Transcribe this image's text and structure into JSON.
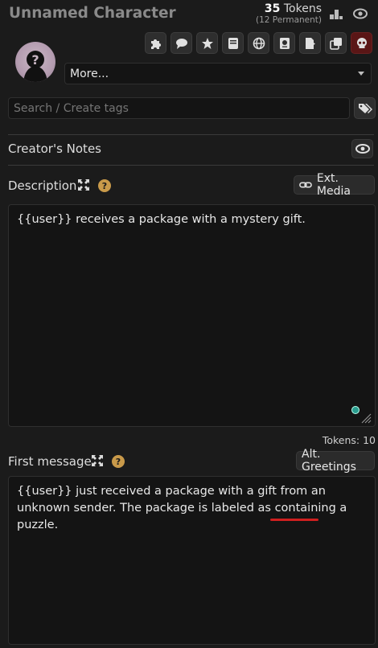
{
  "header": {
    "title": "Unnamed Character",
    "tokens_count": "35",
    "tokens_word": "Tokens",
    "permanent": "(12 Permanent)"
  },
  "toolbar": {
    "icons": [
      "puzzle-icon",
      "comment-icon",
      "star-icon",
      "book-icon",
      "globe-icon",
      "passport-icon",
      "export-icon",
      "clone-icon",
      "skull-icon"
    ],
    "danger_color": "#5a1616"
  },
  "more_select": {
    "value": "More..."
  },
  "tags": {
    "placeholder": "Search / Create tags"
  },
  "creators_notes": {
    "label": "Creator's Notes"
  },
  "description": {
    "label": "Description",
    "help": "?",
    "ext_media": "Ext. Media",
    "text": "{{user}} receives a package with a mystery gift.",
    "tokens": "Tokens: 10"
  },
  "first_message": {
    "label": "First message",
    "help": "?",
    "alt_greetings": "Alt. Greetings",
    "text": "{{user}} just received a package with a gift from an unknown sender. The package is labeled as containing a puzzle."
  },
  "colors": {
    "background": "#1b1b1b",
    "accent_help": "#c99a4a",
    "spell_error": "#d01f1f"
  }
}
